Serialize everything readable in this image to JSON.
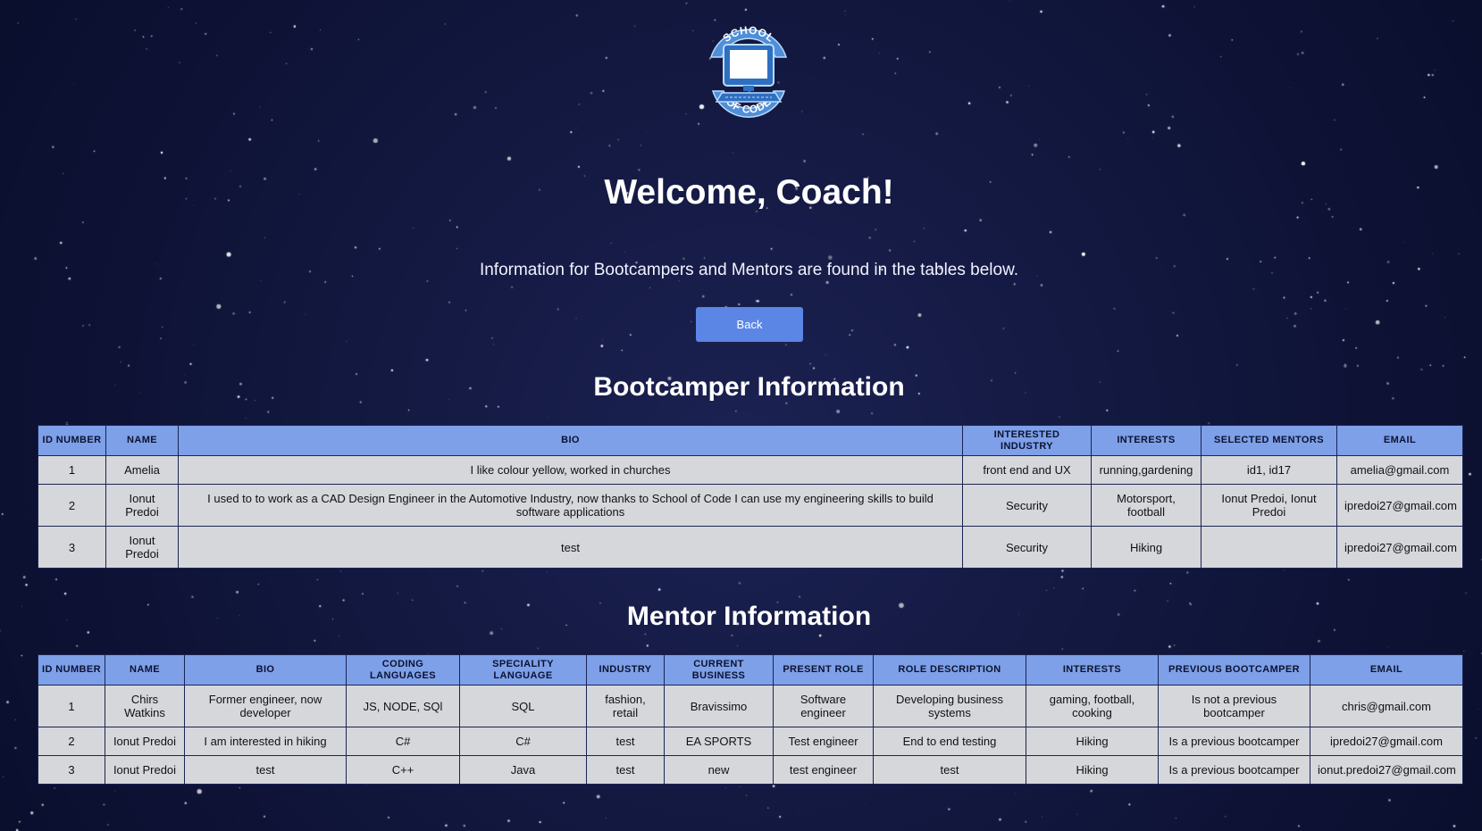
{
  "logo": {
    "top_text": "SCHOOL",
    "bottom_text": "OF CODE",
    "icon": "computer-monitor-icon"
  },
  "header": {
    "title": "Welcome, Coach!",
    "intro": "Information for Bootcampers and Mentors are found in the tables below."
  },
  "back_button": {
    "label": "Back"
  },
  "colors": {
    "background": "#0a0f2e",
    "accent": "#5b86e5",
    "table_header": "#7da0e8",
    "table_cell": "#d6d7db"
  },
  "bootcampers": {
    "title": "Bootcamper Information",
    "columns": [
      "ID NUMBER",
      "NAME",
      "BIO",
      "INTERESTED INDUSTRY",
      "INTERESTS",
      "SELECTED MENTORS",
      "EMAIL"
    ],
    "rows": [
      [
        "1",
        "Amelia",
        "I like colour yellow, worked in churches",
        "front end and UX",
        "running,gardening",
        "id1, id17",
        "amelia@gmail.com"
      ],
      [
        "2",
        "Ionut Predoi",
        "I used to to work as a CAD Design Engineer in the Automotive Industry, now thanks to School of Code I can use my engineering skills to build software applications",
        "Security",
        "Motorsport, football",
        "Ionut Predoi, Ionut Predoi",
        "ipredoi27@gmail.com"
      ],
      [
        "3",
        "Ionut Predoi",
        "test",
        "Security",
        "Hiking",
        "",
        "ipredoi27@gmail.com"
      ]
    ]
  },
  "mentors": {
    "title": "Mentor Information",
    "columns": [
      "ID NUMBER",
      "NAME",
      "BIO",
      "CODING LANGUAGES",
      "SPECIALITY LANGUAGE",
      "INDUSTRY",
      "CURRENT BUSINESS",
      "PRESENT ROLE",
      "ROLE DESCRIPTION",
      "INTERESTS",
      "PREVIOUS BOOTCAMPER",
      "EMAIL"
    ],
    "rows": [
      [
        "1",
        "Chirs Watkins",
        "Former engineer, now developer",
        "JS, NODE, SQl",
        "SQL",
        "fashion, retail",
        "Bravissimo",
        "Software engineer",
        "Developing business systems",
        "gaming, football, cooking",
        "Is not a previous bootcamper",
        "chris@gmail.com"
      ],
      [
        "2",
        "Ionut Predoi",
        "I am interested in hiking",
        "C#",
        "C#",
        "test",
        "EA SPORTS",
        "Test engineer",
        "End to end testing",
        "Hiking",
        "Is a previous bootcamper",
        "ipredoi27@gmail.com"
      ],
      [
        "3",
        "Ionut Predoi",
        "test",
        "C++",
        "Java",
        "test",
        "new",
        "test engineer",
        "test",
        "Hiking",
        "Is a previous bootcamper",
        "ionut.predoi27@gmail.com"
      ]
    ]
  }
}
